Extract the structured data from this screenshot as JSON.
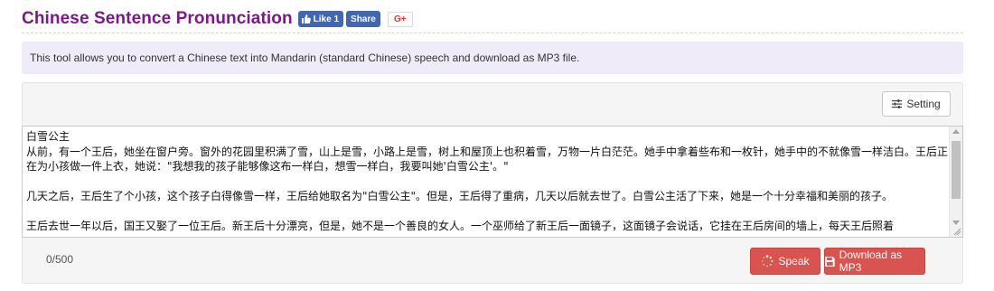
{
  "header": {
    "title": "Chinese Sentence Pronunciation",
    "fb_like_label": "Like 1",
    "fb_share_label": "Share",
    "gplus_label": "G+"
  },
  "info": {
    "text": "This tool allows you to convert a Chinese text into Mandarin (standard Chinese) speech and download as MP3 file."
  },
  "toolbar": {
    "setting_label": "Setting"
  },
  "editor": {
    "text": "白雪公主\n从前，有一个王后，她坐在窗户旁。窗外的花园里积满了雪，山上是雪，小路上是雪，树上和屋顶上也积着雪，万物一片白茫茫。她手中拿着些布和一枚针，她手中的不就像雪一样洁白。王后正在为小孩做一件上衣，她说：\"我想我的孩子能够像这布一样白，想雪一样白，我要叫她'白雪公主'。\"\n\n几天之后，王后生了个小孩，这个孩子白得像雪一样，王后给她取名为\"白雪公主\"。但是，王后得了重病，几天以后就去世了。白雪公主活了下来，她是一个十分幸福和美丽的孩子。\n\n王后去世一年以后，国王又娶了一位王后。新王后十分漂亮，但是，她不是一个善良的女人。一个巫师给了新王后一面镜子，这面镜子会说话，它挂在王后房间的墙上，每天王后照着"
  },
  "footer": {
    "char_count": "0/500",
    "speak_label": "Speak",
    "download_label": "Download as MP3"
  },
  "colors": {
    "title": "#7b1a86",
    "facebook": "#4267b2",
    "info_bg": "#f0ebf9",
    "button_red": "#d9534f"
  }
}
